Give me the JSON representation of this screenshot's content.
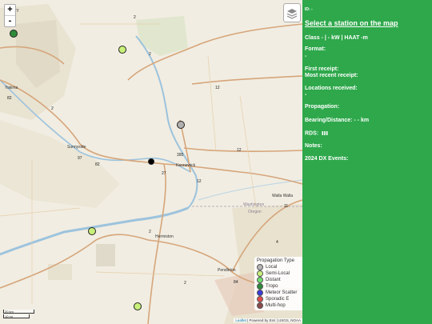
{
  "map": {
    "zoom_in": "+",
    "zoom_out": "-",
    "places": {
      "yakima": "Yakima",
      "sunnyside": "Sunnyside",
      "kennewick": "Kennewick",
      "walla_walla": "Walla Walla",
      "hermiston": "Hermiston",
      "pendleton": "Pendleton",
      "washington": "Washington",
      "oregon": "Oregon",
      "corner": "E...ury"
    },
    "road_numbers": [
      "2",
      "2",
      "2",
      "82",
      "12",
      "395",
      "12",
      "27",
      "2",
      "11",
      "4",
      "2",
      "82",
      "84",
      "97",
      "12"
    ],
    "scale_km": "20 km",
    "scale_mi": "10 mi",
    "attribution_leaflet": "Leaflet",
    "attribution_rest": "| Powered by Esri | USGS, NOAA"
  },
  "stations": [
    {
      "type": "tropo",
      "color": "#2f8a3a"
    },
    {
      "type": "semi-local",
      "color": "#c8f07a"
    },
    {
      "type": "local",
      "color": "#b0b0b0"
    },
    {
      "type": "selected",
      "color": "#000000"
    },
    {
      "type": "semi-local",
      "color": "#c8f07a"
    },
    {
      "type": "semi-local",
      "color": "#c8f07a"
    }
  ],
  "legend": {
    "title": "Propagation Type",
    "items": [
      {
        "label": "Local",
        "color": "#b5b5b5"
      },
      {
        "label": "Semi-Local",
        "color": "#c8f07a"
      },
      {
        "label": "Distant",
        "color": "#6fe06f"
      },
      {
        "label": "Tropo",
        "color": "#2f8a3a"
      },
      {
        "label": "Meteor Scatter",
        "color": "#3a3ad8"
      },
      {
        "label": "Sporadic E",
        "color": "#e04a4a"
      },
      {
        "label": "Multi-hop",
        "color": "#8b4a4a"
      }
    ]
  },
  "panel": {
    "id_line": "ID: -",
    "title": "Select a station on the map",
    "class_line": "Class - | - kW | HAAT -m",
    "format_label": "Format:",
    "format_value": "-",
    "first_receipt": "First receipt:",
    "most_recent": "Most recent receipt:",
    "locations_label": "Locations received:",
    "locations_value": "-",
    "propagation": "Propagation:",
    "bearing": "Bearing/Distance: - - km",
    "rds": "RDS:",
    "notes": "Notes:",
    "events": "2024 DX Events:"
  }
}
